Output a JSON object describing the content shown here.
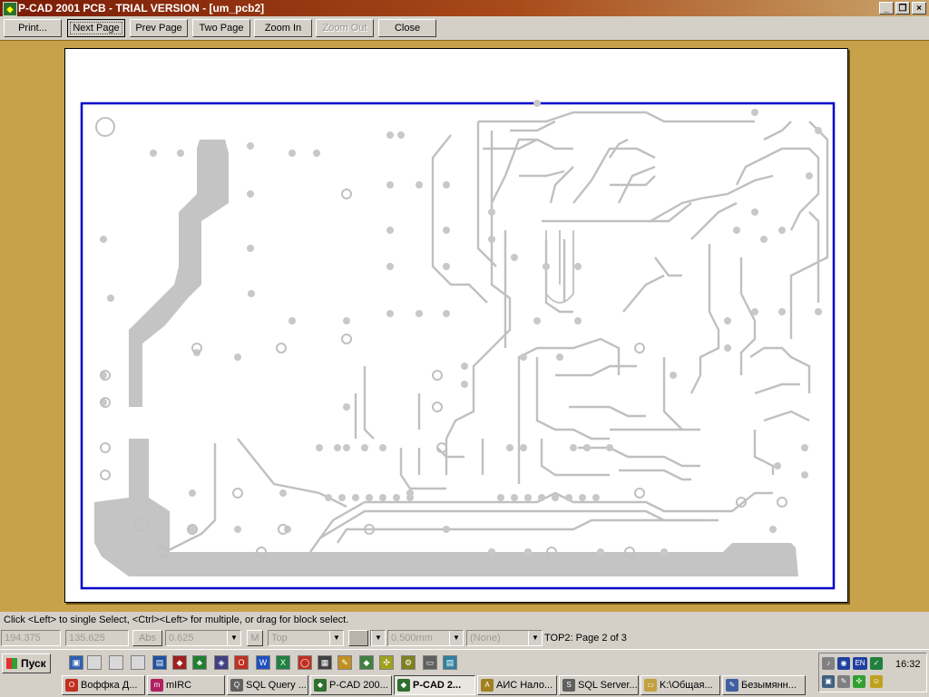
{
  "window": {
    "title": "P-CAD 2001 PCB - TRIAL VERSION  - [um_pcb2]",
    "min_label": "_",
    "restore_label": "❐",
    "close_label": "×"
  },
  "toolbar": {
    "print": "Print...",
    "next_page": "Next Page",
    "prev_page": "Prev Page",
    "two_page": "Two Page",
    "zoom_in": "Zoom In",
    "zoom_out": "Zoom Out",
    "close": "Close"
  },
  "status": {
    "hint": "Click <Left> to single Select, <Ctrl><Left> for multiple, or drag for block select."
  },
  "fields": {
    "x_coord": "194.375",
    "y_coord": "135.625",
    "abs": "Abs",
    "grid": "0.625",
    "m_button": "M",
    "layer": "Top",
    "line_width": "0.500mm",
    "net": "(None)",
    "page_info": "TOP2: Page 2 of 3"
  },
  "taskbar": {
    "start": "Пуск",
    "tasks": [
      {
        "label": "Воффка Д...",
        "icon_color": "#c03020"
      },
      {
        "label": "mIRC",
        "icon_color": "#b02060"
      },
      {
        "label": "SQL Query ...",
        "icon_color": "#606060"
      },
      {
        "label": "P-CAD 200...",
        "icon_color": "#2f6f2f"
      },
      {
        "label": "P-CAD 2...",
        "icon_color": "#2f6f2f"
      },
      {
        "label": "АИС Нало...",
        "icon_color": "#a08020"
      },
      {
        "label": "SQL Server...",
        "icon_color": "#606060"
      },
      {
        "label": "K:\\Общая...",
        "icon_color": "#c0a040"
      },
      {
        "label": "Безымянн...",
        "icon_color": "#4060a0"
      }
    ],
    "clock": "16:32",
    "lang": "EN"
  },
  "colors": {
    "workspace": "#c8a24a",
    "board_outline": "#0000cc",
    "trace": "#c0c0c0"
  }
}
